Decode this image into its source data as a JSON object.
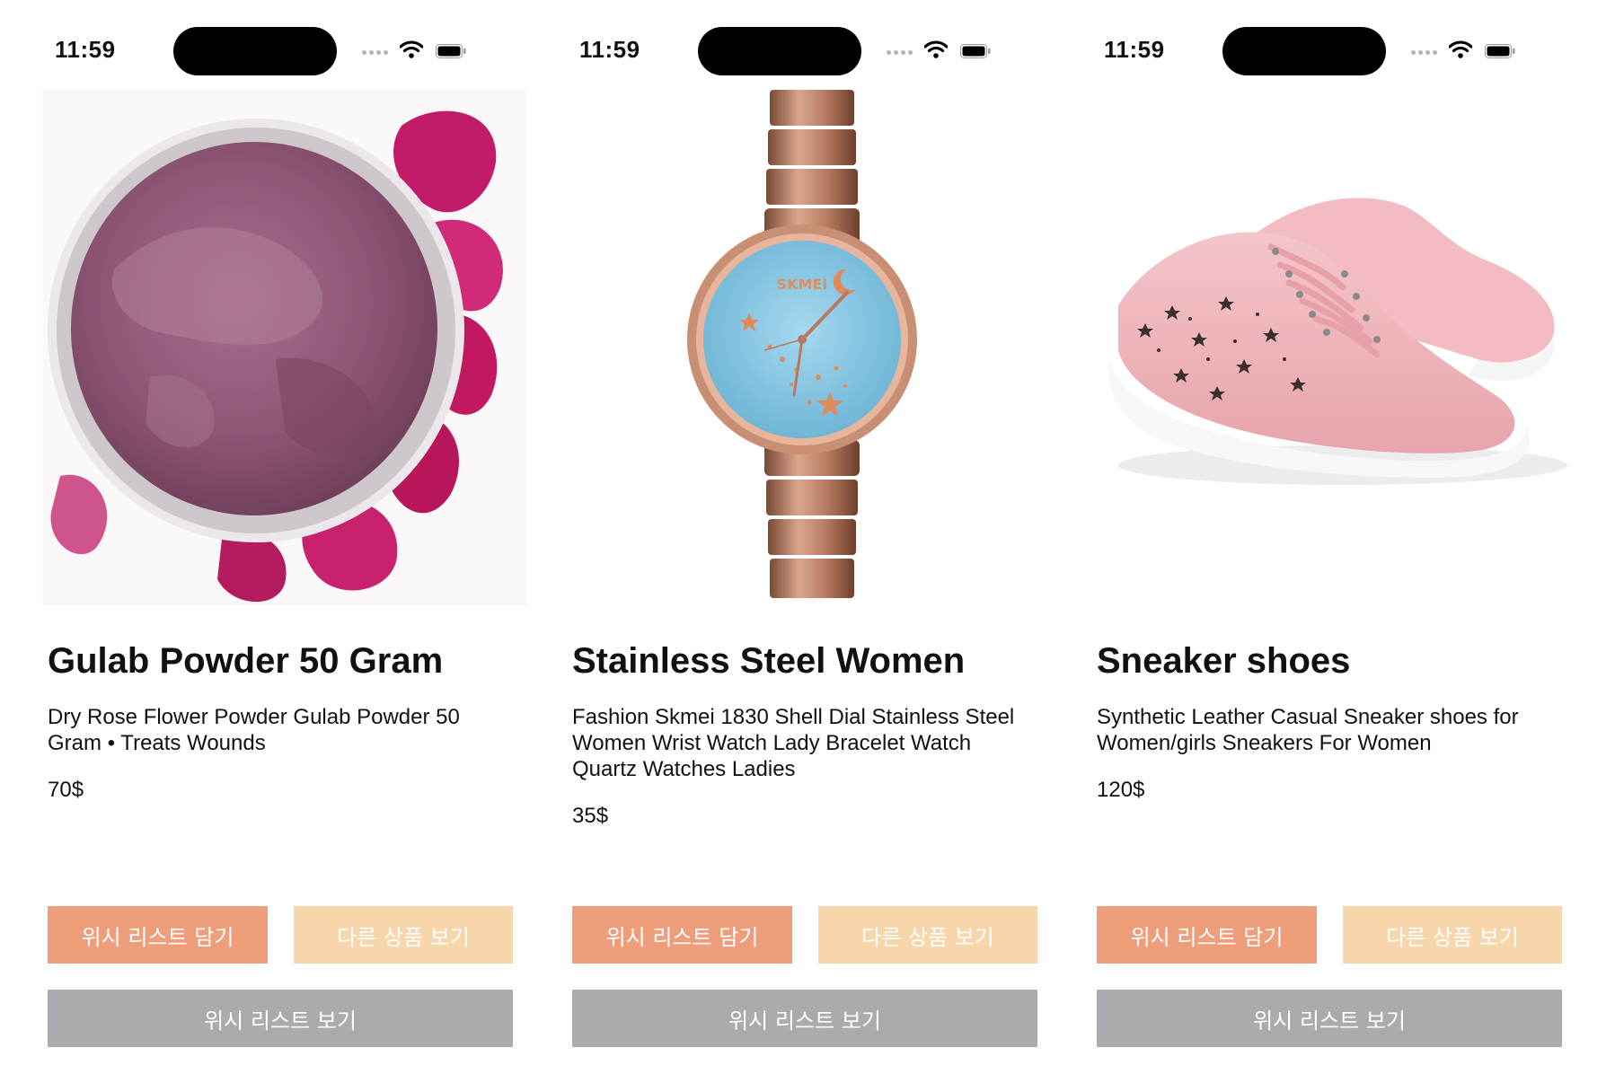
{
  "colors": {
    "wish_button": "#ef9e7c",
    "other_button": "#f8d6ab",
    "view_button": "#abaaaf"
  },
  "screens": [
    {
      "status_time": "11:59",
      "title": "Gulab Powder 50 Gram",
      "description": "Dry Rose Flower Powder Gulab Powder 50 Gram • Treats Wounds",
      "price": "70$",
      "image_icon": "rose-powder-image",
      "buttons": {
        "wish": "위시 리스트 담기",
        "other": "다른 상품 보기",
        "view": "위시 리스트 보기"
      }
    },
    {
      "status_time": "11:59",
      "title": "Stainless Steel Women",
      "description": "Fashion Skmei 1830 Shell Dial Stainless Steel Women Wrist Watch Lady Bracelet Watch Quartz Watches Ladies",
      "price": "35$",
      "image_icon": "wrist-watch-image",
      "watch_brand": "SKMEI",
      "buttons": {
        "wish": "위시 리스트 담기",
        "other": "다른 상품 보기",
        "view": "위시 리스트 보기"
      }
    },
    {
      "status_time": "11:59",
      "title": "Sneaker shoes",
      "description": "Synthetic Leather Casual Sneaker shoes for Women/girls Sneakers For Women",
      "price": "120$",
      "image_icon": "pink-sneakers-image",
      "buttons": {
        "wish": "위시 리스트 담기",
        "other": "다른 상품 보기",
        "view": "위시 리스트 보기"
      }
    }
  ]
}
